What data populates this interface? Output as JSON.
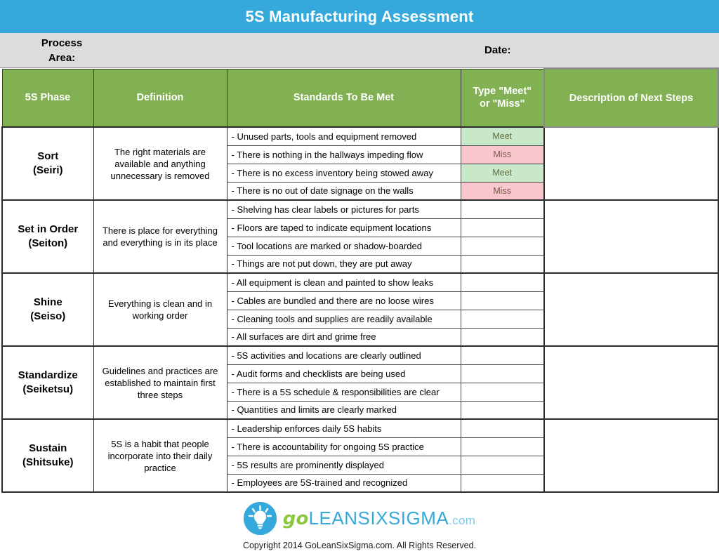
{
  "header": {
    "title": "5S Manufacturing Assessment",
    "bar_color": "#35A8DC"
  },
  "meta": {
    "process_area_label": "Process\nArea:",
    "date_label": "Date:",
    "band_color": "#DCDCDC"
  },
  "table": {
    "header_color": "#81B153",
    "meet_color": "#C9E8CA",
    "miss_color": "#F9C6CE",
    "columns": [
      {
        "key": "phase",
        "label": "5S Phase"
      },
      {
        "key": "definition",
        "label": "Definition"
      },
      {
        "key": "standards",
        "label": "Standards To Be Met"
      },
      {
        "key": "type",
        "label": "Type \"Meet\"\nor \"Miss\""
      },
      {
        "key": "description",
        "label": "Description of Next Steps"
      }
    ],
    "sections": [
      {
        "phase": "Sort\n(Seiri)",
        "definition": "The right materials are available and anything unnecessary is removed",
        "description": "",
        "rows": [
          {
            "standard": "- Unused parts, tools and equipment removed",
            "type": "Meet"
          },
          {
            "standard": "- There is nothing in the hallways impeding flow",
            "type": "Miss"
          },
          {
            "standard": "- There is no excess inventory being stowed away",
            "type": "Meet"
          },
          {
            "standard": "- There is no out of date signage on the walls",
            "type": "Miss"
          }
        ]
      },
      {
        "phase": "Set in Order\n(Seiton)",
        "definition": "There is place for everything and everything is in its place",
        "description": "",
        "rows": [
          {
            "standard": "- Shelving has clear labels or pictures for parts",
            "type": ""
          },
          {
            "standard": "- Floors are taped to indicate equipment locations",
            "type": ""
          },
          {
            "standard": "- Tool locations are marked or shadow-boarded",
            "type": ""
          },
          {
            "standard": "- Things are not put down, they are put away",
            "type": ""
          }
        ]
      },
      {
        "phase": "Shine\n(Seiso)",
        "definition": "Everything is clean and in working order",
        "description": "",
        "rows": [
          {
            "standard": "- All equipment is clean and painted to show leaks",
            "type": ""
          },
          {
            "standard": "- Cables are bundled and there are no loose wires",
            "type": ""
          },
          {
            "standard": "- Cleaning tools and supplies are readily available",
            "type": ""
          },
          {
            "standard": "- All surfaces are dirt and grime free",
            "type": ""
          }
        ]
      },
      {
        "phase": "Standardize\n(Seiketsu)",
        "definition": "Guidelines and practices are established to maintain first three steps",
        "description": "",
        "rows": [
          {
            "standard": "- 5S activities and locations are clearly outlined",
            "type": ""
          },
          {
            "standard": "- Audit forms and checklists are being used",
            "type": ""
          },
          {
            "standard": "- There is a 5S schedule & responsibilities are clear",
            "type": ""
          },
          {
            "standard": "- Quantities and limits are clearly marked",
            "type": ""
          }
        ]
      },
      {
        "phase": "Sustain\n(Shitsuke)",
        "definition": "5S is a habit that people incorporate into their daily practice",
        "description": "",
        "rows": [
          {
            "standard": "- Leadership enforces daily 5S habits",
            "type": ""
          },
          {
            "standard": "- There is accountability for ongoing 5S practice",
            "type": ""
          },
          {
            "standard": "- 5S results are prominently displayed",
            "type": ""
          },
          {
            "standard": "- Employees are 5S-trained and recognized",
            "type": ""
          }
        ]
      }
    ]
  },
  "footer": {
    "logo": {
      "go": "go",
      "main": "LEANSIXSIGMA",
      "com": ".com",
      "go_color": "#8DC63F",
      "main_color": "#35A8DC"
    },
    "copyright": "Copyright 2014 GoLeanSixSigma.com. All Rights Reserved."
  }
}
